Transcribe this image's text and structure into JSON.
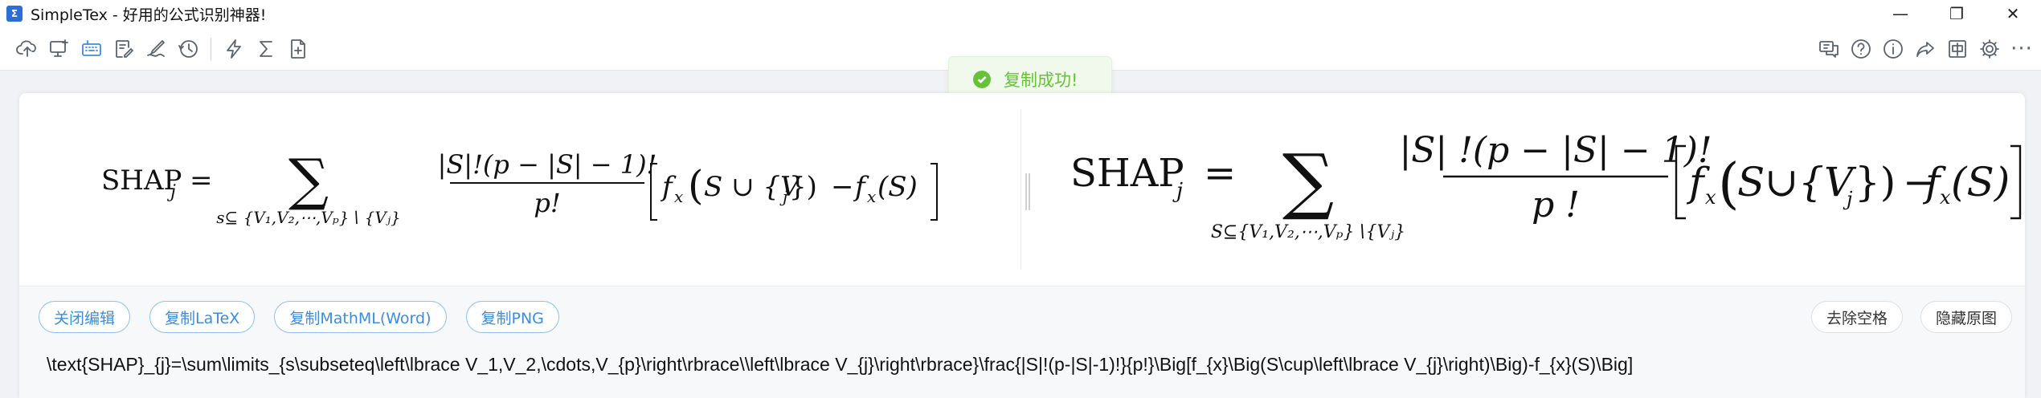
{
  "window": {
    "app_icon_text": "Σ",
    "title": "SimpleTex - 好用的公式识别神器!",
    "controls": {
      "minimize": "—",
      "maximize": "❐",
      "close": "✕"
    }
  },
  "toolbar": {
    "left_icons": [
      "upload-cloud-icon",
      "screen-capture-icon",
      "keyboard-icon",
      "edit-document-icon",
      "handwrite-icon",
      "history-icon",
      "lightning-icon",
      "sigma-icon",
      "new-file-icon"
    ],
    "right_icons": [
      "feedback-icon",
      "help-icon",
      "info-icon",
      "share-icon",
      "language-icon",
      "settings-icon"
    ],
    "more_label": "···"
  },
  "toast": {
    "message": "复制成功!",
    "color": "#67c23a"
  },
  "formula": {
    "left": {
      "lhs": "SHAP",
      "lhs_sub": "j",
      "eq": "=",
      "sum": "∑",
      "sum_sub": "s⊆ {V₁,V₂,⋯,Vₚ}∖ {Vⱼ}",
      "numerator": "|S|!(p − |S| − 1)!",
      "denominator": "p!",
      "bracket_body": "f",
      "rhs_tail": "(S)"
    },
    "right": {
      "lhs": "SHAP",
      "lhs_sub": "j",
      "eq": "=",
      "sum": "∑",
      "sum_sub": "S⊆{V₁,V₂,⋯,Vₚ}∖{Vⱼ}",
      "numerator": "|S| !(p − |S| − 1)!",
      "denominator": "p !"
    }
  },
  "actions": {
    "close_edit": "关闭编辑",
    "copy_latex": "复制LaTeX",
    "copy_mathml": "复制MathML(Word)",
    "copy_png": "复制PNG",
    "remove_spaces": "去除空格",
    "hide_original": "隐藏原图"
  },
  "latex": {
    "value": "\\text{SHAP}_{j}=\\sum\\limits_{s\\subseteq\\left\\lbrace V_1,V_2,\\cdots,V_{p}\\right\\rbrace\\\\left\\lbrace V_{j}\\right\\rbrace}\\frac{|S|!(p-|S|-1)!}{p!}\\Big[f_{x}\\Big(S\\cup\\left\\lbrace V_{j}\\right)\\Big)-f_{x}(S)\\Big]"
  },
  "colors": {
    "accent": "#3b8de0",
    "success": "#67c23a",
    "icon": "#5a6270"
  }
}
